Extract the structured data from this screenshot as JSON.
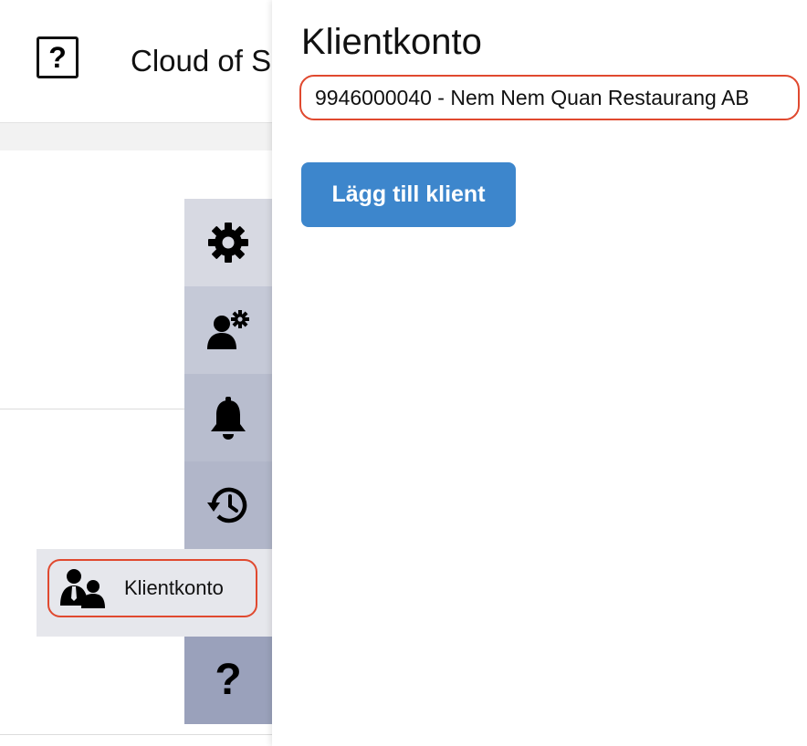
{
  "header": {
    "help_glyph": "?",
    "app_title": "Cloud of S"
  },
  "rail": {
    "items": [
      {
        "icon": "gear-icon",
        "bg": "#d7d9e2"
      },
      {
        "icon": "user-gear-icon",
        "bg": "#c5c9d7"
      },
      {
        "icon": "bell-icon",
        "bg": "#b8bdce"
      },
      {
        "icon": "history-icon",
        "bg": "#b1b6c9"
      },
      {
        "icon": "users-icon",
        "label": "Klientkonto",
        "bg": "#e6e7ec"
      },
      {
        "icon": "question-icon",
        "glyph": "?",
        "bg": "#9aa1bb"
      }
    ]
  },
  "panel": {
    "title": "Klientkonto",
    "client": "9946000040 - Nem Nem Quan Restaurang AB",
    "add_button": "Lägg till klient"
  },
  "colors": {
    "highlight": "#e0492f",
    "primary": "#3d86cc"
  }
}
